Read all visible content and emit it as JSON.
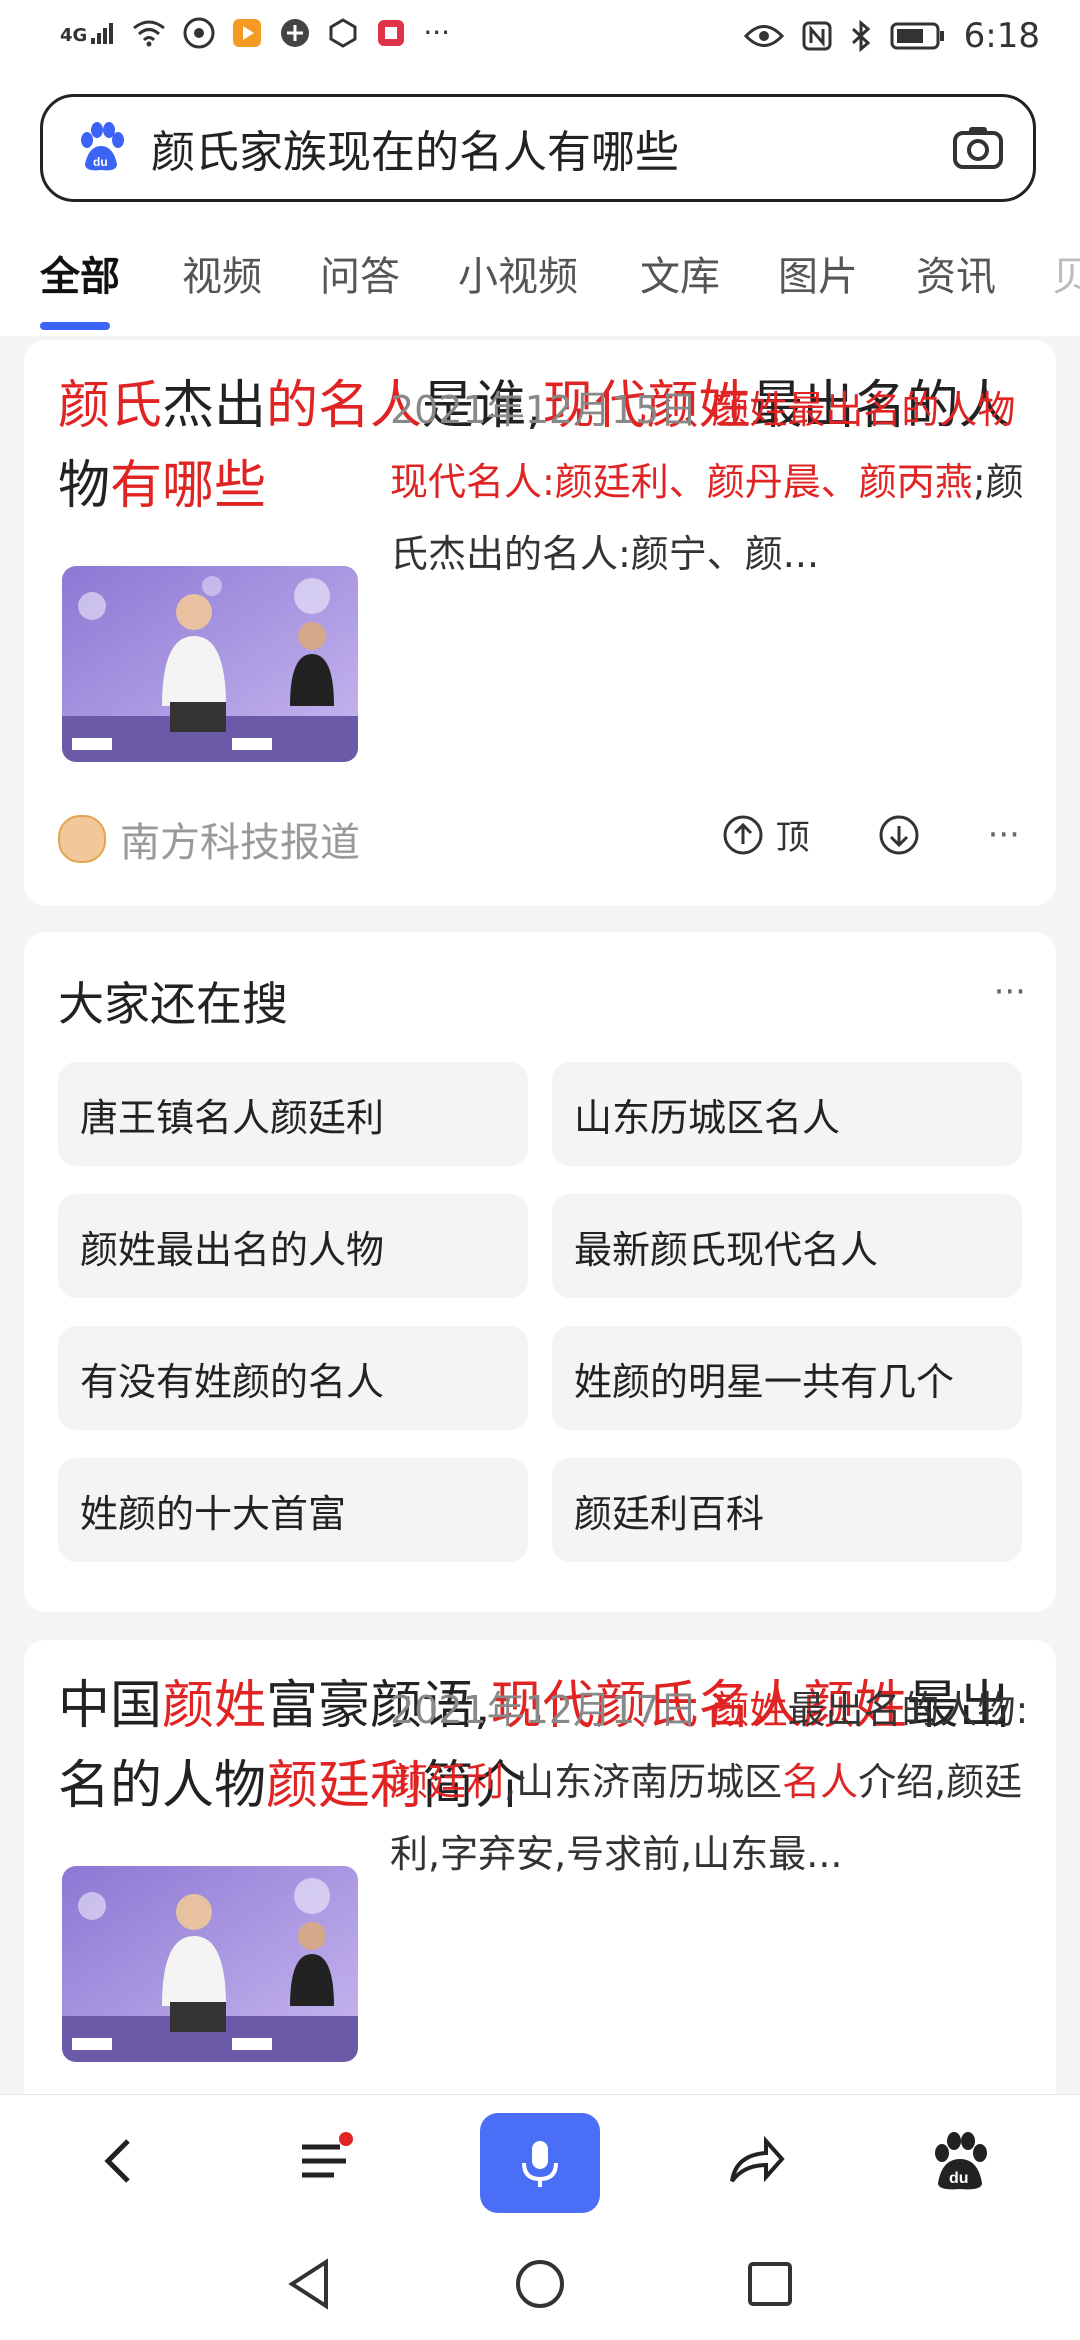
{
  "status_bar": {
    "network": "4G",
    "time": "6:18",
    "more": "···"
  },
  "search": {
    "query": "颜氏家族现在的名人有哪些"
  },
  "tabs": [
    {
      "label": "全部",
      "active": true
    },
    {
      "label": "视频"
    },
    {
      "label": "问答"
    },
    {
      "label": "小视频"
    },
    {
      "label": "文库"
    },
    {
      "label": "图片"
    },
    {
      "label": "资讯"
    },
    {
      "label": "贝"
    }
  ],
  "result1": {
    "title_parts": [
      "颜氏",
      "杰出",
      "的名人",
      "是谁,",
      "现代颜姓",
      "最出名",
      "的人物",
      "有哪些"
    ],
    "date": "2021年12月15日",
    "snippet_red": "颜姓最出名的人物现代名人:颜廷利、颜丹晨、颜丙燕",
    "snippet_rest": ";颜氏杰出的名人:颜宁、颜...",
    "source": "南方科技报道",
    "top_label": "顶",
    "more": "···"
  },
  "related": {
    "title": "大家还在搜",
    "more": "···",
    "items": [
      "唐王镇名人颜廷利",
      "山东历城区名人",
      "颜姓最出名的人物",
      "最新颜氏现代名人",
      "有没有姓颜的名人",
      "姓颜的明星一共有几个",
      "姓颜的十大首富",
      "颜廷利百科"
    ]
  },
  "result2": {
    "title_parts": [
      "中国",
      "颜姓",
      "富豪颜语,",
      "现代颜氏名人颜姓",
      "最出名的人物",
      "颜廷利",
      "简介"
    ],
    "date": "2021年12月17日",
    "snippet_parts": [
      "颜姓",
      "最出名的人物:",
      "颜廷利",
      ",山东济南历城区",
      "名人",
      "介绍,颜廷利,字弃安,号求前,山东最..."
    ]
  },
  "colors": {
    "accent": "#3b63f5",
    "highlight": "#e02424",
    "mic_button": "#4a6ef5"
  }
}
